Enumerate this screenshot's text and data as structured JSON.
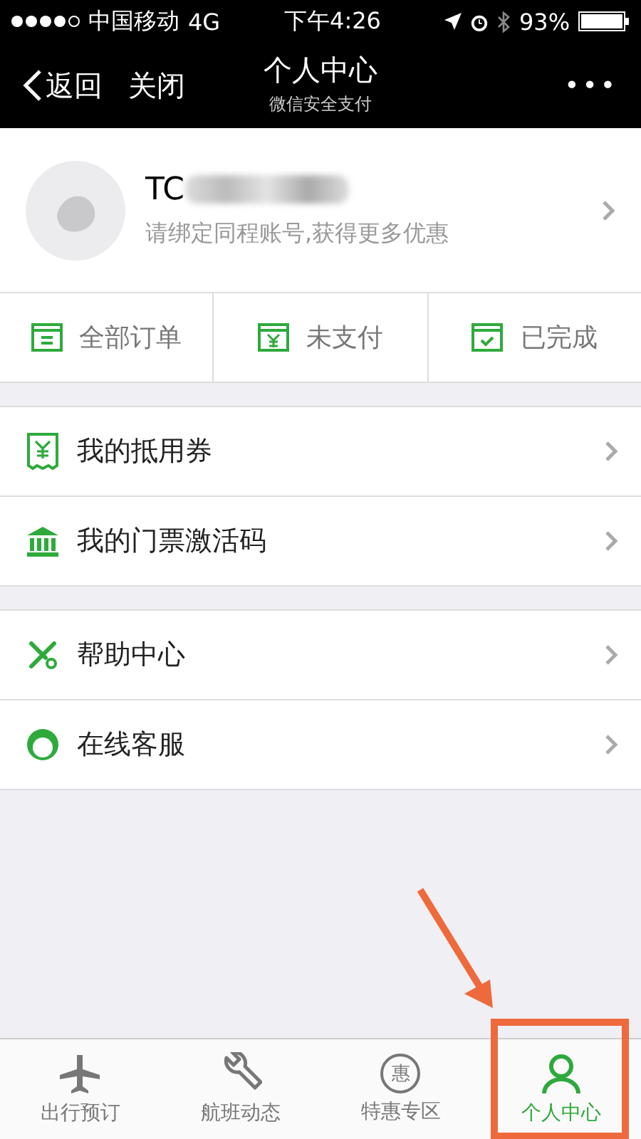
{
  "status_bar": {
    "carrier": "中国移动",
    "network": "4G",
    "time": "下午4:26",
    "battery": "93%"
  },
  "nav": {
    "back": "返回",
    "close": "关闭",
    "title": "个人中心",
    "subtitle": "微信安全支付",
    "more": "•••"
  },
  "profile": {
    "name": "TC",
    "hint": "请绑定同程账号,获得更多优惠"
  },
  "order_tabs": [
    {
      "kind": "list",
      "label": "全部订单"
    },
    {
      "kind": "yuan",
      "label": "未支付"
    },
    {
      "kind": "check",
      "label": "已完成"
    }
  ],
  "menu_groups": [
    [
      {
        "kind": "voucher",
        "label": "我的抵用券"
      },
      {
        "kind": "bank",
        "label": "我的门票激活码"
      }
    ],
    [
      {
        "kind": "tools",
        "label": "帮助中心"
      },
      {
        "kind": "agent",
        "label": "在线客服"
      }
    ]
  ],
  "tab_bar": [
    {
      "kind": "plane",
      "label": "出行预订",
      "selected": false
    },
    {
      "kind": "wrench",
      "label": "航班动态",
      "selected": false
    },
    {
      "kind": "badge",
      "badge_text": "惠",
      "label": "特惠专区",
      "selected": false
    },
    {
      "kind": "person",
      "label": "个人中心",
      "selected": true
    }
  ]
}
